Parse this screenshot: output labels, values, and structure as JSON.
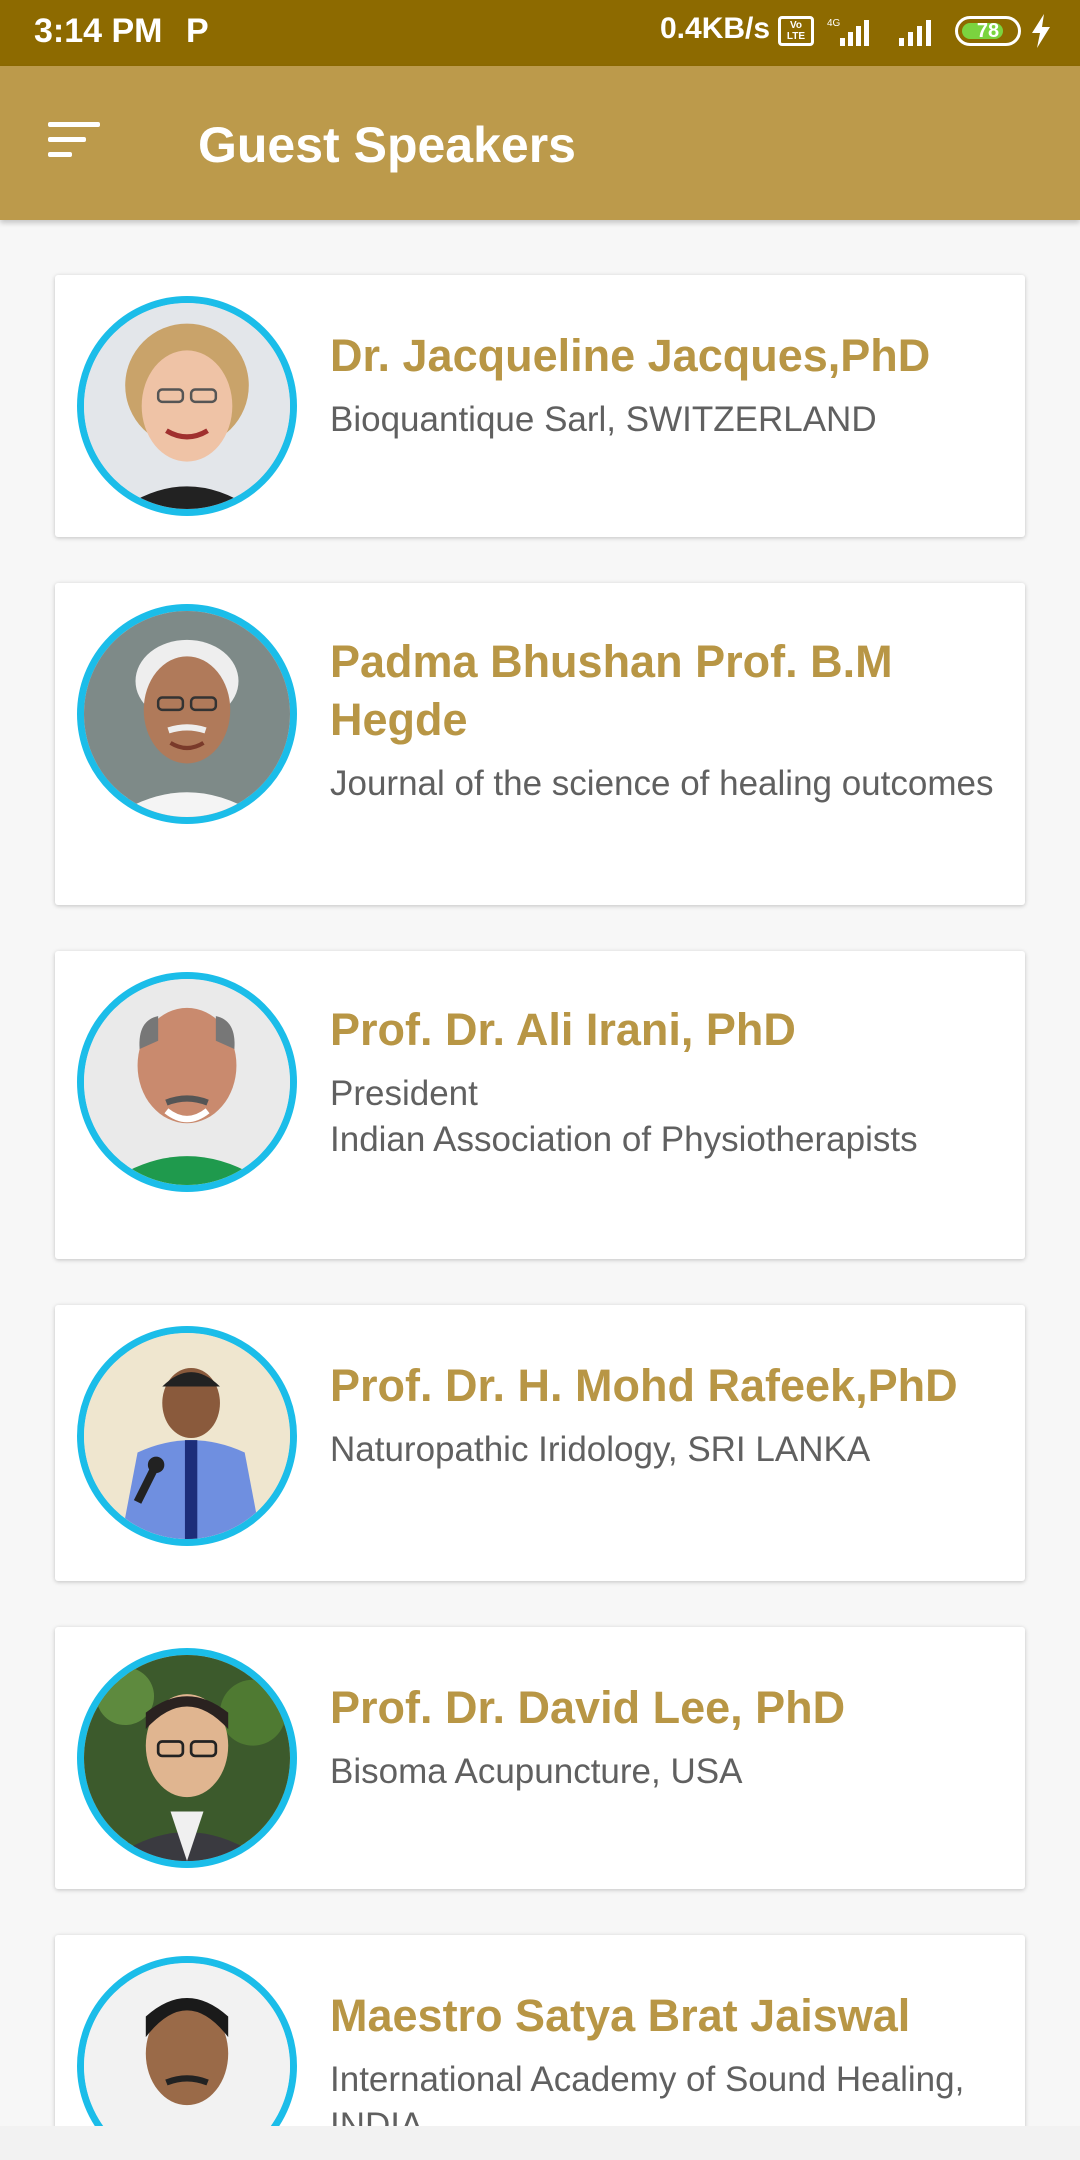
{
  "status_bar": {
    "time": "3:14 PM",
    "notification_letter": "P",
    "net_speed": "0.4KB/s",
    "volte_label": "Vo LTE",
    "network_type": "4G",
    "battery": "78",
    "battery_level": 0.78
  },
  "app_bar": {
    "title": "Guest Speakers",
    "menu_icon": "sort-menu-icon"
  },
  "colors": {
    "status_bar": "#8d6a00",
    "app_bar": "#bc9a4b",
    "name_text": "#b89645",
    "avatar_ring": "#1bbde9"
  },
  "speakers": [
    {
      "name": "Dr. Jacqueline Jacques,PhD",
      "organization": "Bioquantique Sarl, SWITZERLAND"
    },
    {
      "name": "Padma Bhushan Prof. B.M Hegde",
      "organization": "Journal of the science of healing outcomes"
    },
    {
      "name": "Prof. Dr. Ali Irani, PhD",
      "organization": "President\nIndian Association of Physiotherapists"
    },
    {
      "name": "Prof. Dr. H. Mohd Rafeek,PhD",
      "organization": "Naturopathic Iridology, SRI LANKA"
    },
    {
      "name": "Prof. Dr. David Lee, PhD",
      "organization": "Bisoma Acupuncture, USA"
    },
    {
      "name": "Maestro Satya Brat Jaiswal",
      "organization": "International Academy of Sound Healing, INDIA"
    }
  ]
}
